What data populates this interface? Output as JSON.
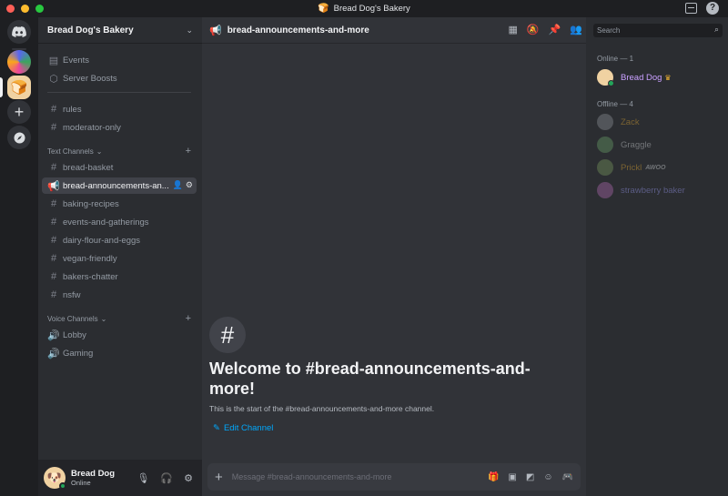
{
  "window": {
    "title": "Bread Dog's Bakery"
  },
  "server": {
    "name": "Bread Dog's Bakery"
  },
  "channels": {
    "top": [
      {
        "label": "Events",
        "icon": "calendar-icon"
      },
      {
        "label": "Server Boosts",
        "icon": "boost-icon"
      }
    ],
    "uncategorized": [
      {
        "label": "rules",
        "icon": "hash-icon"
      },
      {
        "label": "moderator-only",
        "icon": "locked-hash-icon"
      }
    ],
    "text_category": "Text Channels",
    "text": [
      {
        "label": "bread-basket"
      },
      {
        "label": "bread-announcements-an..."
      },
      {
        "label": "baking-recipes"
      },
      {
        "label": "events-and-gatherings"
      },
      {
        "label": "dairy-flour-and-eggs"
      },
      {
        "label": "vegan-friendly"
      },
      {
        "label": "bakers-chatter"
      },
      {
        "label": "nsfw"
      }
    ],
    "voice_category": "Voice Channels",
    "voice": [
      {
        "label": "Lobby"
      },
      {
        "label": "Gaming"
      }
    ]
  },
  "user": {
    "name": "Bread Dog",
    "status": "Online"
  },
  "chat": {
    "channel_name": "bread-announcements-and-more",
    "welcome_title": "Welcome to #bread-announcements-and-more!",
    "welcome_sub": "This is the start of the #bread-announcements-and-more channel.",
    "edit_label": "Edit Channel",
    "composer_placeholder": "Message #bread-announcements-and-more"
  },
  "members": {
    "search_placeholder": "Search",
    "online_header": "Online — 1",
    "offline_header": "Offline — 4",
    "online": [
      {
        "name": "Bread Dog",
        "color": "#c9a0ff"
      }
    ],
    "offline": [
      {
        "name": "Zack",
        "color": "#f0b232"
      },
      {
        "name": "Graggle",
        "color": "#dbdee1"
      },
      {
        "name": "Prickl",
        "color": "#f0b232",
        "tag": "AWOO"
      },
      {
        "name": "strawberry baker",
        "color": "#a0a0ff"
      }
    ]
  },
  "colors": {
    "accent": "#5865f2",
    "link": "#00a8fc",
    "online": "#23a55a"
  }
}
